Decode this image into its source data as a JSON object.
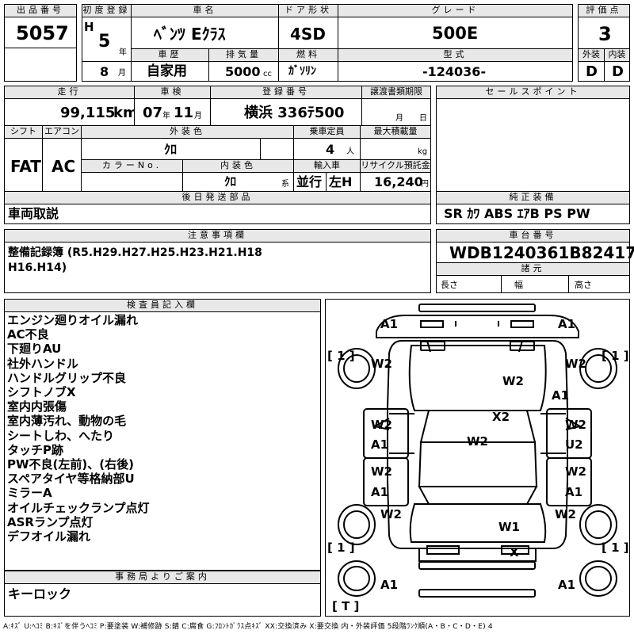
{
  "header": {
    "lot_label": "出品番号",
    "lot_number": "5057",
    "first_reg_label": "初度登録",
    "era": "H",
    "year": "5",
    "year_unit": "年",
    "month": "8",
    "month_unit": "月",
    "car_name_label": "車名",
    "car_name": "ﾍﾞﾝﾂ Eｸﾗｽ",
    "door_label": "ドア形状",
    "door": "4SD",
    "grade_label": "グレード",
    "grade": "500E",
    "score_label": "評価点",
    "score": "3",
    "history_label": "車歴",
    "history": "自家用",
    "displacement_label": "排気量",
    "displacement": "5000",
    "displacement_unit": "cc",
    "fuel_label": "燃料",
    "fuel": "ｶﾞｿﾘﾝ",
    "model_code_label": "型式",
    "model_code": "-124036-",
    "exterior_label": "外装",
    "exterior": "D",
    "interior_label": "内装",
    "interior": "D"
  },
  "details": {
    "mileage_label": "走行",
    "mileage": "99,115",
    "mileage_unit": "km",
    "inspection_label": "車検",
    "inspection_year": "07",
    "inspection_year_unit": "年",
    "inspection_month": "11",
    "inspection_month_unit": "月",
    "plate_label": "登録番号",
    "plate": "横浜 336ﾃ500",
    "transfer_doc_label": "譲渡書類期限",
    "transfer_month_unit": "月",
    "transfer_day_unit": "日",
    "shift_label": "シフト",
    "shift": "FAT",
    "ac_label": "エアコン",
    "ac": "AC",
    "color_label": "外装色",
    "color": "ｸﾛ",
    "capacity_label": "乗車定員",
    "capacity": "4",
    "capacity_unit": "人",
    "max_load_label": "最大積載量",
    "max_load_unit": "kg",
    "color_no_label": "カラーNo.",
    "interior_color_label": "内装色",
    "interior_color": "ｸﾛ",
    "interior_color_unit": "系",
    "import_label": "輸入車",
    "import_type": "並行",
    "handle_side": "左H",
    "recycle_label": "リサイクル預託金",
    "recycle": "16,240",
    "recycle_unit": "円"
  },
  "sales_point": {
    "label": "セールスポイント",
    "text": ""
  },
  "later_parts": {
    "label": "後日発送部品",
    "text": "車両取説"
  },
  "equipment": {
    "label": "純正装備",
    "text": "SR ｶﾜ ABS ｴｱB PS PW"
  },
  "caution": {
    "label": "注意事項欄",
    "line1": "整備記録簿 (R5.H29.H27.H25.H23.H21.H18",
    "line2": "H16.H14)"
  },
  "chassis": {
    "label": "車台番号",
    "number": "WDB1240361B824178",
    "dims_label": "諸元",
    "length_label": "長さ",
    "width_label": "幅",
    "height_label": "高さ"
  },
  "inspector": {
    "label": "検査員記入欄",
    "notes": [
      "エンジン廻りオイル漏れ",
      "AC不良",
      "下廻りAU",
      "社外ハンドル",
      "ハンドルグリップ不良",
      "シフトノブX",
      "室内内張傷",
      "室内薄汚れ、動物の毛",
      "シートしわ、へたり",
      "タッチP跡",
      "PW不良(左前)、(右後)",
      "スペアタイヤ等格納部U",
      "ミラーA",
      "オイルチェックランプ点灯",
      "ASRランプ点灯",
      "デフオイル漏れ"
    ]
  },
  "office": {
    "label": "事務局よりご案内",
    "text": "キーロック"
  },
  "diagram": {
    "marks": {
      "front_left": "A1",
      "front_right": "A1",
      "bracket_fl": "[ 1 ]",
      "bracket_fr": "[ 1 ]",
      "fender_fl": "W2",
      "fender_fr": "W2",
      "hood_mid": "W2",
      "hood_right": "A1",
      "windshield": "X2",
      "roof": "W2",
      "door_fl_top": "W2",
      "door_fl_bot": "A1",
      "door_fr_top": "W2",
      "door_fr_bot": "U2",
      "door_rl_top": "W2",
      "door_rl_bot": "A1",
      "door_rr_top": "W2",
      "door_rr_bot": "A1",
      "fender_rl": "W2",
      "fender_rr": "W2",
      "trunk": "W1",
      "rear_plate": "X",
      "bracket_rl": "[ 1 ]",
      "bracket_rr": "[ 1 ]",
      "rear_left": "A1",
      "rear_right": "A1",
      "spare": "[ T ]"
    }
  },
  "footer": {
    "legend": "A:ｷｽﾞ U:ﾍｺﾐ B:ｷｽﾞを伴うﾍｺﾐ P:要塗装 W:補修跡 S:錆 C:腐食 G:ﾌﾛﾝﾄｶﾞﾗｽ点ｷｽﾞ XX:交換済み X:要交換 内・外装評価 5段階ﾗﾝｸ順(A・B・C・D・E) 4"
  }
}
